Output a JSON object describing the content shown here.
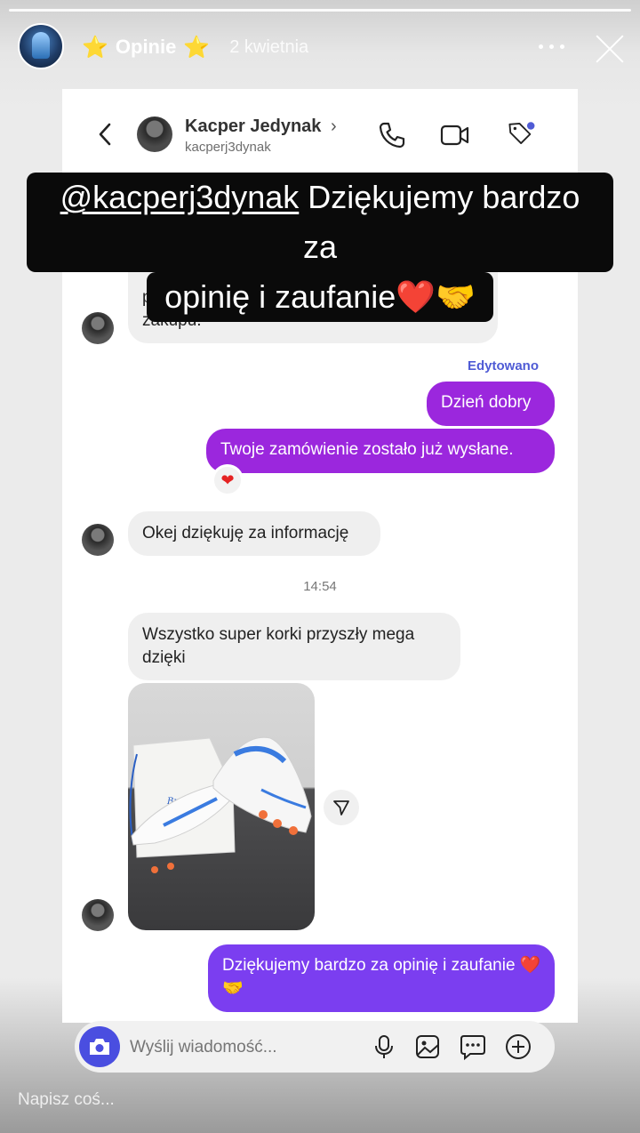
{
  "story": {
    "title": "Opinie",
    "title_star": "⭐",
    "date": "2 kwietnia",
    "reply_placeholder": "Napisz coś..."
  },
  "dm": {
    "contact_name": "Kacper Jedynak",
    "contact_chevron": "›",
    "contact_username": "kacperj3dynak",
    "messages": [
      {
        "from": "them",
        "text": "przychodzi zamówienie? Dziś dokonałem zakupu."
      },
      {
        "from": "me",
        "label": "Edytowano",
        "text": "Dzień dobry"
      },
      {
        "from": "me",
        "text": "Twoje zamówienie zostało już wysłane."
      },
      {
        "from": "them",
        "text": "Okej dziękuję za informację"
      },
      {
        "from": "time",
        "text": "14:54"
      },
      {
        "from": "them",
        "text": "Wszystko super korki przyszły mega dzięki"
      },
      {
        "from": "me",
        "text": "Dziękujemy bardzo za opinię i zaufanie ❤️🤝"
      }
    ],
    "reaction": "❤",
    "composer_placeholder": "Wyślij wiadomość..."
  },
  "caption": {
    "mention": "@kacperj3dynak",
    "line1_rest": " Dziękujemy bardzo za",
    "line2": "opinię i zaufanie❤️🤝"
  },
  "colors": {
    "outgoing_bubble": "#9b27dd",
    "outgoing_bubble_last": "#7b3ef0",
    "edited_label": "#4f5bd5",
    "camera_button": "#4a4ee0"
  },
  "icons": [
    "back-arrow-icon",
    "phone-icon",
    "video-icon",
    "tag-icon",
    "send-share-icon",
    "camera-icon",
    "microphone-icon",
    "gallery-icon",
    "sticker-chat-icon",
    "plus-icon",
    "more-dots-icon",
    "close-icon",
    "star-icon"
  ]
}
